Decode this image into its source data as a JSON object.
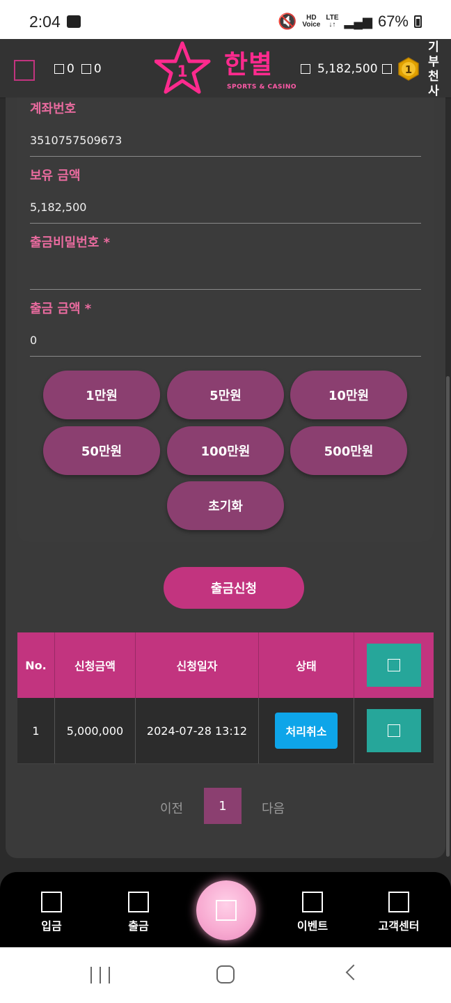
{
  "status_bar": {
    "time": "2:04",
    "hd_voice": "HD",
    "lte": "LTE",
    "battery": "67%"
  },
  "header": {
    "count_a": "0",
    "count_b": "0",
    "brand_main": "한별",
    "brand_sub": "SPORTS & CASINO",
    "logo_badge": "1",
    "balance": "5,182,500",
    "level_badge": "1",
    "vertical_menu": [
      "기",
      "부",
      "천",
      "사"
    ]
  },
  "form": {
    "account_label": "계좌번호",
    "account_value": "3510757509673",
    "holding_label": "보유 금액",
    "holding_value": "5,182,500",
    "password_label": "출금비밀번호 *",
    "password_value": "",
    "amount_label": "출금 금액 *",
    "amount_value": "0",
    "amount_buttons": [
      "1만원",
      "5만원",
      "10만원",
      "50만원",
      "100만원",
      "500만원"
    ],
    "reset_label": "초기화",
    "submit_label": "출금신청"
  },
  "table": {
    "headers": [
      "No.",
      "신청금액",
      "신청일자",
      "상태"
    ],
    "rows": [
      {
        "no": "1",
        "amount": "5,000,000",
        "date": "2024-07-28 13:12",
        "status": "처리취소"
      }
    ]
  },
  "pagination": {
    "prev": "이전",
    "current": "1",
    "next": "다음"
  },
  "bottom_nav": {
    "items": [
      "입금",
      "출금",
      "이벤트",
      "고객센터"
    ]
  },
  "colors": {
    "accent": "#c2347f",
    "button": "#8b3f70",
    "label": "#e96b9f",
    "teal": "#26a69a",
    "status_blue": "#0ea5e9"
  }
}
